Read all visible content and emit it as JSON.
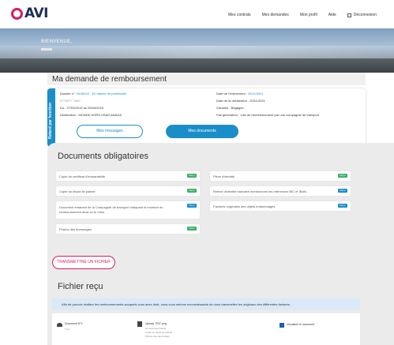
{
  "header": {
    "logo_text": "AVI",
    "nav": [
      "Mes contrats",
      "Mes demandes",
      "Mon profil",
      "Aide",
      "Déconnexion"
    ]
  },
  "hero": {
    "greeting": "BIENVENUE,"
  },
  "request": {
    "title": "Ma demande de remboursement",
    "side_label": "Retard par fonction",
    "dossier_label": "Dossier n°: ",
    "dossier_value": "H108102 - En attente de justificatifs",
    "ref": "5775377 7650",
    "dates": "Du : 27/03/2019 au 05/04/2019",
    "destination": "Destination : MONDE HORS USA/CANADA",
    "event_label": "Date de l'événement : ",
    "event_date": "20/11/2021",
    "declaration": "Date de la déclaration : 20/11/2021",
    "guarantee": "Garantie : Bagages",
    "cause": "Fait générateur : Liés de l'acheminement par une compagnie de transport",
    "btn_messages": "Mes messages",
    "btn_documents": "Mes documents"
  },
  "documents": {
    "title": "Documents obligatoires",
    "left_items": [
      {
        "label": "Copie du certificat d'irréparabilité",
        "badge": "Reçu"
      },
      {
        "label": "Copie du dépôt de plainte",
        "badge": "Reçu"
      },
      {
        "label": "Document émanant de la Compagnie de transport indiquant le montant du remboursement ainsi ou le refus",
        "badge": "Reçu"
      },
      {
        "label": "Photos des dommages",
        "badge": "Reçu"
      }
    ],
    "right_items": [
      {
        "label": "Pièce d'identité",
        "badge": "Reçu"
      },
      {
        "label": "Relevé d'identité bancaire mentionnant les références BIC et IBAN.",
        "badge": "Reçu"
      },
      {
        "label": "Factures originales des objets endommagés",
        "badge": "Reçu"
      }
    ],
    "btn_transmit": "TRANSMETTRE UN FICHIER"
  },
  "received": {
    "title": "Fichier reçu",
    "info": "Afin de pouvoir réaliser les remboursements auxquels vous avez droit, nous vous serions reconnaissants de nous transmettre les originaux des différentes factures.",
    "file1_name": "Document N°1",
    "file1_sub": "5 Mo",
    "file2_name": "Upload 7037.png",
    "file2_lines": [
      "Un document lisible",
      "Copie du dépôt de plainte",
      "Photos des dommages"
    ],
    "view_label": "Visualiser le document"
  },
  "colors": {
    "brand_pink": "#d81b60",
    "brand_navy": "#1f2f55",
    "accent_blue": "#1a8ec9",
    "badge_green": "#3cb067"
  }
}
